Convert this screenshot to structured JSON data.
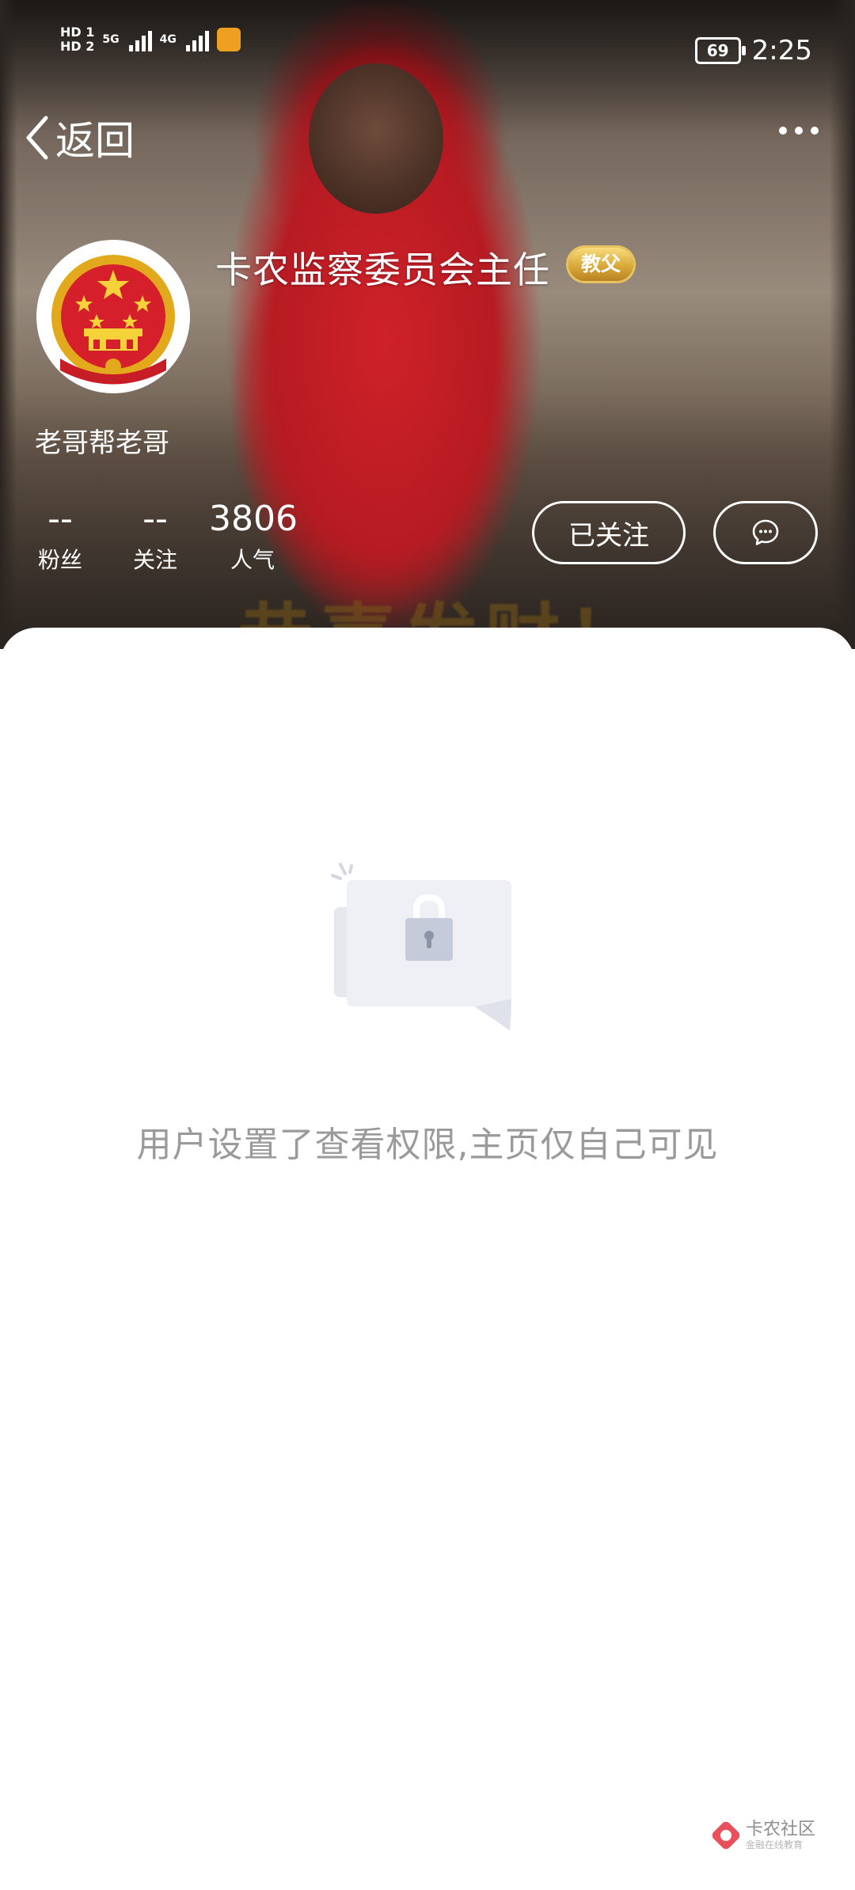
{
  "status_bar": {
    "sim1": "HD 1",
    "sim2": "HD 2",
    "network1": "5G",
    "network2": "4G",
    "battery": "69",
    "time": "2:25"
  },
  "nav": {
    "back_label": "返回",
    "more_icon": "more-horizontal-icon"
  },
  "profile": {
    "username": "卡农监察委员会主任",
    "badge": "教父",
    "subname": "老哥帮老哥",
    "avatar_icon": "national-emblem",
    "banner_text": "恭喜发财！",
    "stats": [
      {
        "value": "--",
        "label": "粉丝"
      },
      {
        "value": "--",
        "label": "关注"
      },
      {
        "value": "3806",
        "label": "人气"
      }
    ],
    "follow_label": "已关注",
    "chat_icon": "chat-bubble-icon"
  },
  "content": {
    "empty_message": "用户设置了查看权限,主页仅自己可见",
    "illustration_icon": "lock-icon"
  },
  "watermark": {
    "title": "卡农社区",
    "subtitle": "金融在线教育"
  },
  "colors": {
    "accent_red": "#c41e24",
    "badge_gold": "#d9a93a",
    "message_gray": "#9a9a9a"
  }
}
